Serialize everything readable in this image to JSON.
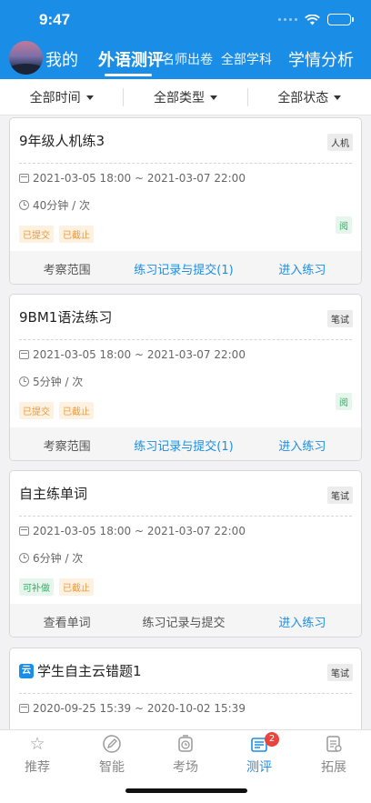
{
  "status_bar": {
    "time": "9:47"
  },
  "nav": {
    "me": "我的",
    "tabs": [
      {
        "label": "外语测评"
      },
      {
        "label": "名师出卷"
      },
      {
        "label": "全部学科"
      },
      {
        "label": "学情分析"
      }
    ]
  },
  "filters": [
    {
      "label": "全部时间"
    },
    {
      "label": "全部类型"
    },
    {
      "label": "全部状态"
    }
  ],
  "cards": [
    {
      "title": "9年级人机练3",
      "type": "人机",
      "date": "2021-03-05 18:00 ~ 2021-03-07 22:00",
      "duration": "40分钟 / 次",
      "tags": [
        "已提交",
        "已截止"
      ],
      "read_badge": "阅",
      "actions": [
        "考察范围",
        "练习记录与提交(1)",
        "进入练习"
      ]
    },
    {
      "title": "9BM1语法练习",
      "type": "笔试",
      "date": "2021-03-05 18:00 ~ 2021-03-07 22:00",
      "duration": "5分钟 / 次",
      "tags": [
        "已提交",
        "已截止"
      ],
      "read_badge": "阅",
      "actions": [
        "考察范围",
        "练习记录与提交(1)",
        "进入练习"
      ]
    },
    {
      "title": "自主练单词",
      "type": "笔试",
      "date": "2021-03-05 18:00 ~ 2021-03-07 22:00",
      "duration": "6分钟 / 次",
      "tags": [
        "可补做",
        "已截止"
      ],
      "actions": [
        "查看单词",
        "练习记录与提交",
        "进入练习"
      ]
    },
    {
      "title": "学生自主云错题1",
      "type": "笔试",
      "date": "2020-09-25 15:39 ~ 2020-10-02 15:39"
    }
  ],
  "tabbar": {
    "items": [
      {
        "label": "推荐",
        "icon": "star-icon"
      },
      {
        "label": "智能",
        "icon": "pen-icon"
      },
      {
        "label": "考场",
        "icon": "timer-icon"
      },
      {
        "label": "测评",
        "icon": "test-paper-icon",
        "badge": "2"
      },
      {
        "label": "拓展",
        "icon": "expand-icon"
      }
    ]
  },
  "colors": {
    "brand": "#1a8ee6",
    "badge": "#e8453c",
    "orange_tag": "#e89a3c",
    "green_tag": "#3aaa68"
  }
}
